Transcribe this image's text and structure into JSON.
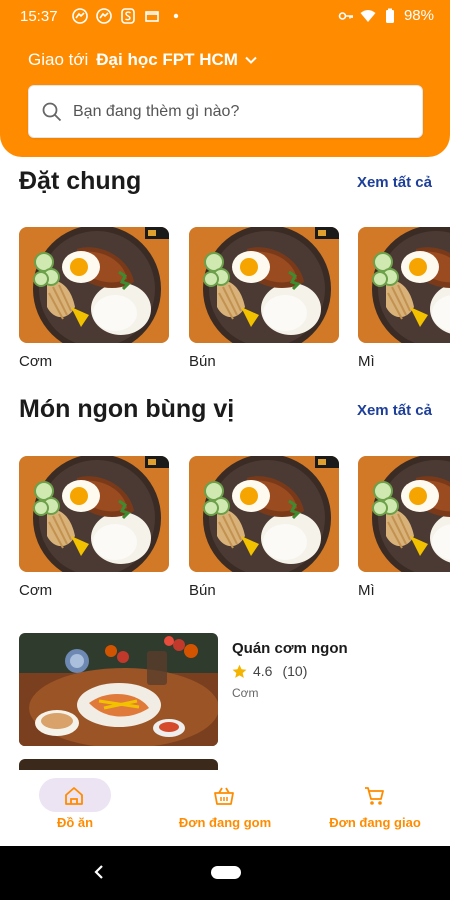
{
  "status": {
    "time": "15:37",
    "battery": "98%",
    "left_icons": [
      "messenger-icon",
      "messenger-icon",
      "s-logo-icon",
      "window-icon",
      "dot-icon"
    ],
    "right_icons": [
      "key-icon",
      "wifi-icon",
      "battery-icon"
    ]
  },
  "header": {
    "deliver_label": "Giao tới",
    "deliver_place": "Đại học FPT HCM",
    "search_placeholder": "Bạn đang thèm gì nào?",
    "accent": "#ff8c00"
  },
  "sections": [
    {
      "title": "Đặt chung",
      "see_all": "Xem tất cả",
      "items": [
        {
          "label": "Cơm"
        },
        {
          "label": "Bún"
        },
        {
          "label": "Mì"
        }
      ]
    },
    {
      "title": "Món ngon bùng vị",
      "see_all": "Xem tất cả",
      "items": [
        {
          "label": "Cơm"
        },
        {
          "label": "Bún"
        },
        {
          "label": "Mì"
        }
      ]
    }
  ],
  "restaurant": {
    "name": "Quán cơm ngon",
    "rating": "4.6",
    "reviews": "(10)",
    "category": "Cơm"
  },
  "bottom_nav": [
    {
      "label": "Đồ ăn",
      "icon": "home-icon",
      "active": true
    },
    {
      "label": "Đơn đang gom",
      "icon": "basket-icon",
      "active": false
    },
    {
      "label": "Đơn đang giao",
      "icon": "cart-icon",
      "active": false
    }
  ]
}
